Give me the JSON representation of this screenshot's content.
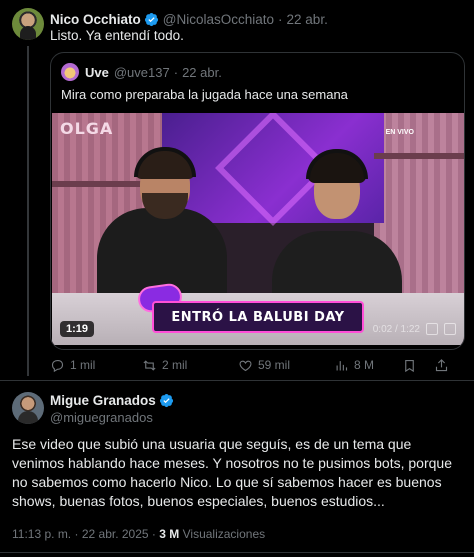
{
  "tweet1": {
    "author_name": "Nico Occhiato",
    "handle": "@NicolasOcchiato",
    "separator": "·",
    "date": "22 abr.",
    "text": "Listo. Ya entendí todo.",
    "quote": {
      "author_name": "Uve",
      "handle": "@uve137",
      "separator": "·",
      "date": "22 abr.",
      "text": "Mira como preparaba la jugada hace una semana",
      "video": {
        "duration": "1:19",
        "elapsed": "0:02 / 1:22",
        "wall_sign": "OLGA",
        "live_label": "EN VIVO",
        "banner_text": "ENTRÓ LA BALUBI DAY"
      }
    },
    "actions": {
      "replies": "1 mil",
      "retweets": "2 mil",
      "likes": "59 mil",
      "views": "8 M"
    }
  },
  "tweet2": {
    "author_name": "Migue Granados",
    "handle": "@miguegranados",
    "text": "Ese video que subió una usuaria que seguís, es de un tema que venimos hablando hace meses. Y nosotros no te pusimos bots, porque no sabemos como hacerlo Nico. Lo que sí sabemos hacer es buenos shows, buenas fotos, buenos especiales, buenos estudios...",
    "time": "11:13 p. m.",
    "separator": "·",
    "date": "22 abr. 2025",
    "separator2": "·",
    "views_count": "3 M",
    "views_label": "Visualizaciones"
  },
  "colors": {
    "background": "#000000",
    "text": "#e7e9ea",
    "muted": "#71767b",
    "verified": "#1d9bf0",
    "border": "#2f3336"
  }
}
